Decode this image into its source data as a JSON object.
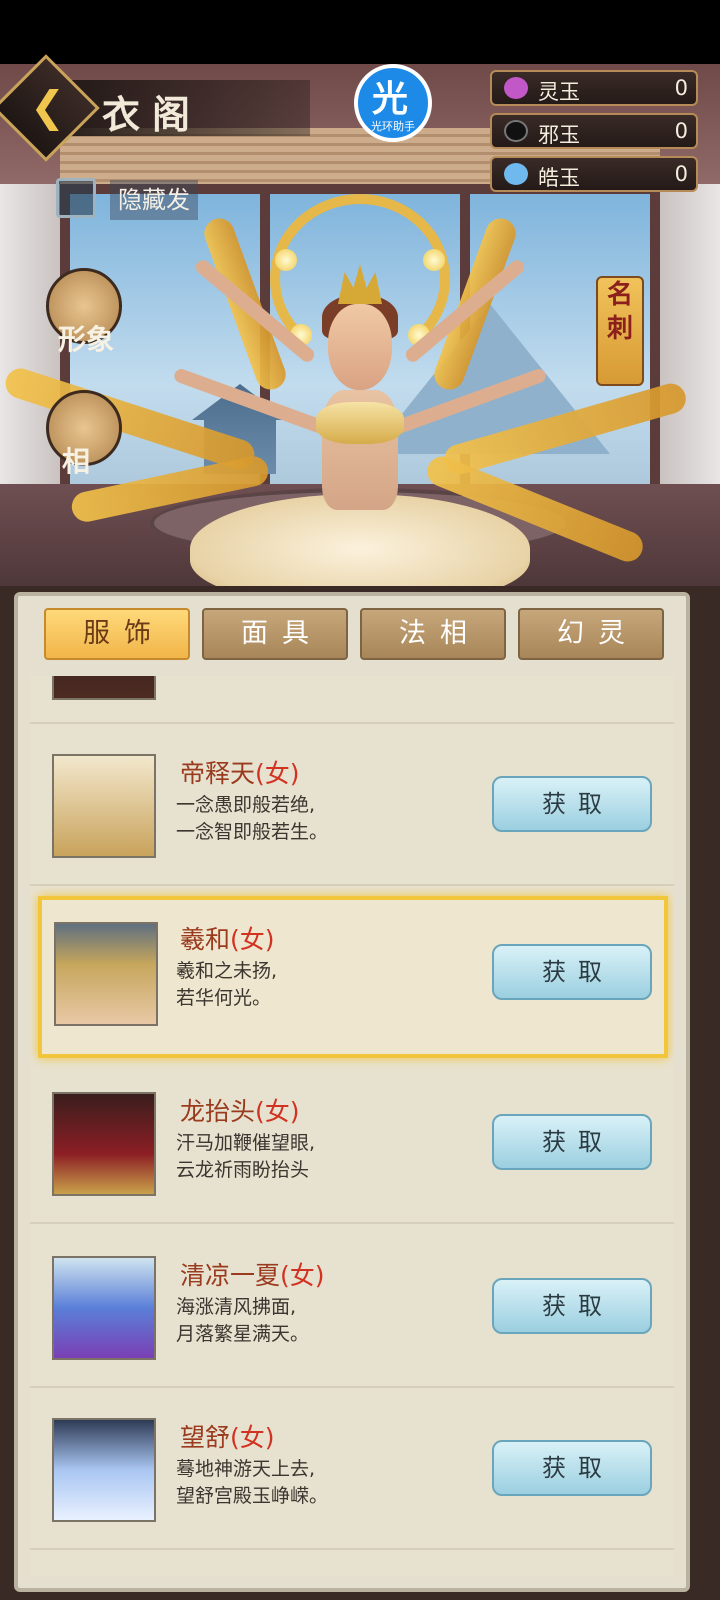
{
  "header": {
    "title": "衣阁",
    "back_icon": "back-chevron-icon",
    "logo_char": "光",
    "logo_text": "光环助手"
  },
  "hide_toggle": {
    "label": "隐藏发"
  },
  "currencies": [
    {
      "name": "灵玉",
      "value": "0",
      "icon": "spirit-jade-icon",
      "color": "#c257c8"
    },
    {
      "name": "邪玉",
      "value": "0",
      "icon": "evil-jade-icon",
      "color": "#111111"
    },
    {
      "name": "皓玉",
      "value": "0",
      "icon": "bright-jade-icon",
      "color": "#6fb9ef"
    }
  ],
  "side_buttons": [
    {
      "label": "形象",
      "icon": "avatar-icon"
    },
    {
      "label": "相",
      "icon": "fist-icon"
    }
  ],
  "right_seal": {
    "chars": [
      "名",
      "刺"
    ]
  },
  "tabs": [
    {
      "label": "服饰",
      "active": true
    },
    {
      "label": "面具",
      "active": false
    },
    {
      "label": "法相",
      "active": false
    },
    {
      "label": "幻灵",
      "active": false
    }
  ],
  "items": [
    {
      "name": "帝释天",
      "gender": "(女)",
      "desc": "一念愚即般若绝,\n一念智即般若生。",
      "button": "获取",
      "selected": false
    },
    {
      "name": "羲和",
      "gender": "(女)",
      "desc": "羲和之未扬,\n若华何光。",
      "button": "获取",
      "selected": true
    },
    {
      "name": "龙抬头",
      "gender": "(女)",
      "desc": "汗马加鞭催望眼,\n云龙祈雨盼抬头",
      "button": "获取",
      "selected": false
    },
    {
      "name": "清凉一夏",
      "gender": "(女)",
      "desc": "海涨清风拂面,\n月落繁星满天。",
      "button": "获取",
      "selected": false
    },
    {
      "name": "望舒",
      "gender": "(女)",
      "desc": "蓦地神游天上去,\n望舒宫殿玉峥嵘。",
      "button": "获取",
      "selected": false
    }
  ],
  "colors": {
    "accent": "#f2c63a",
    "panel": "#e5dfcf",
    "button": "#9bcfe0"
  }
}
